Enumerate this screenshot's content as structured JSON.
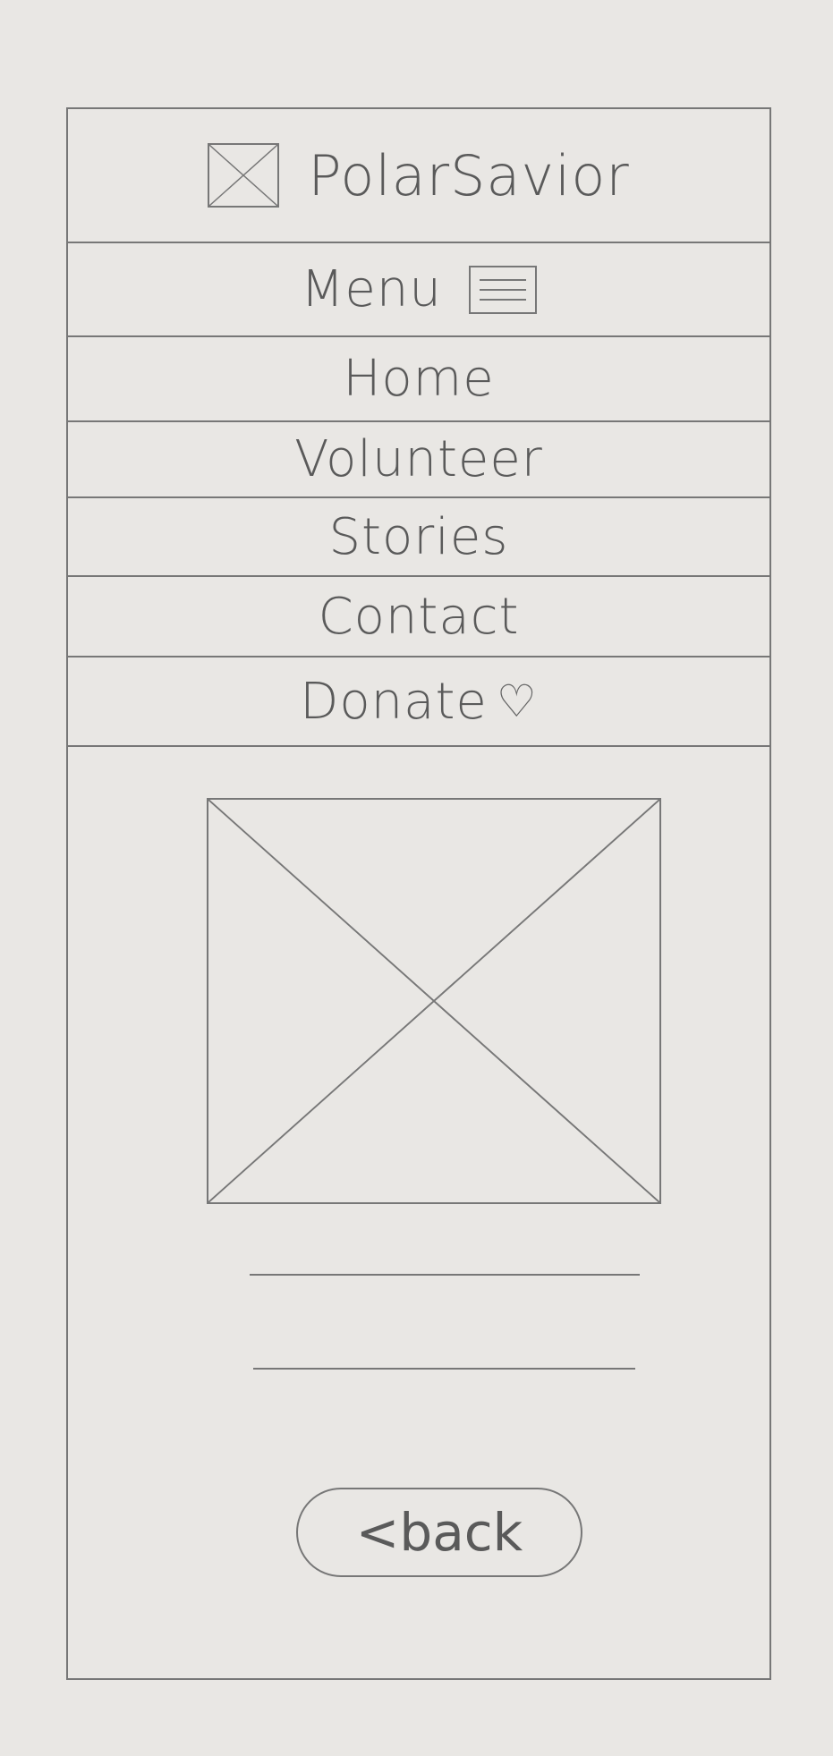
{
  "header": {
    "logo_icon": "placeholder-image-icon",
    "title": "PolarSavior"
  },
  "menu": {
    "label": "Menu",
    "icon": "hamburger-menu-icon"
  },
  "nav": {
    "home": "Home",
    "volunteer": "Volunteer",
    "stories": "Stories",
    "contact": "Contact",
    "donate": "Donate",
    "donate_icon": "heart-icon",
    "heart_glyph": "♡"
  },
  "content": {
    "image": "placeholder-image"
  },
  "footer": {
    "back_label": "<back"
  }
}
